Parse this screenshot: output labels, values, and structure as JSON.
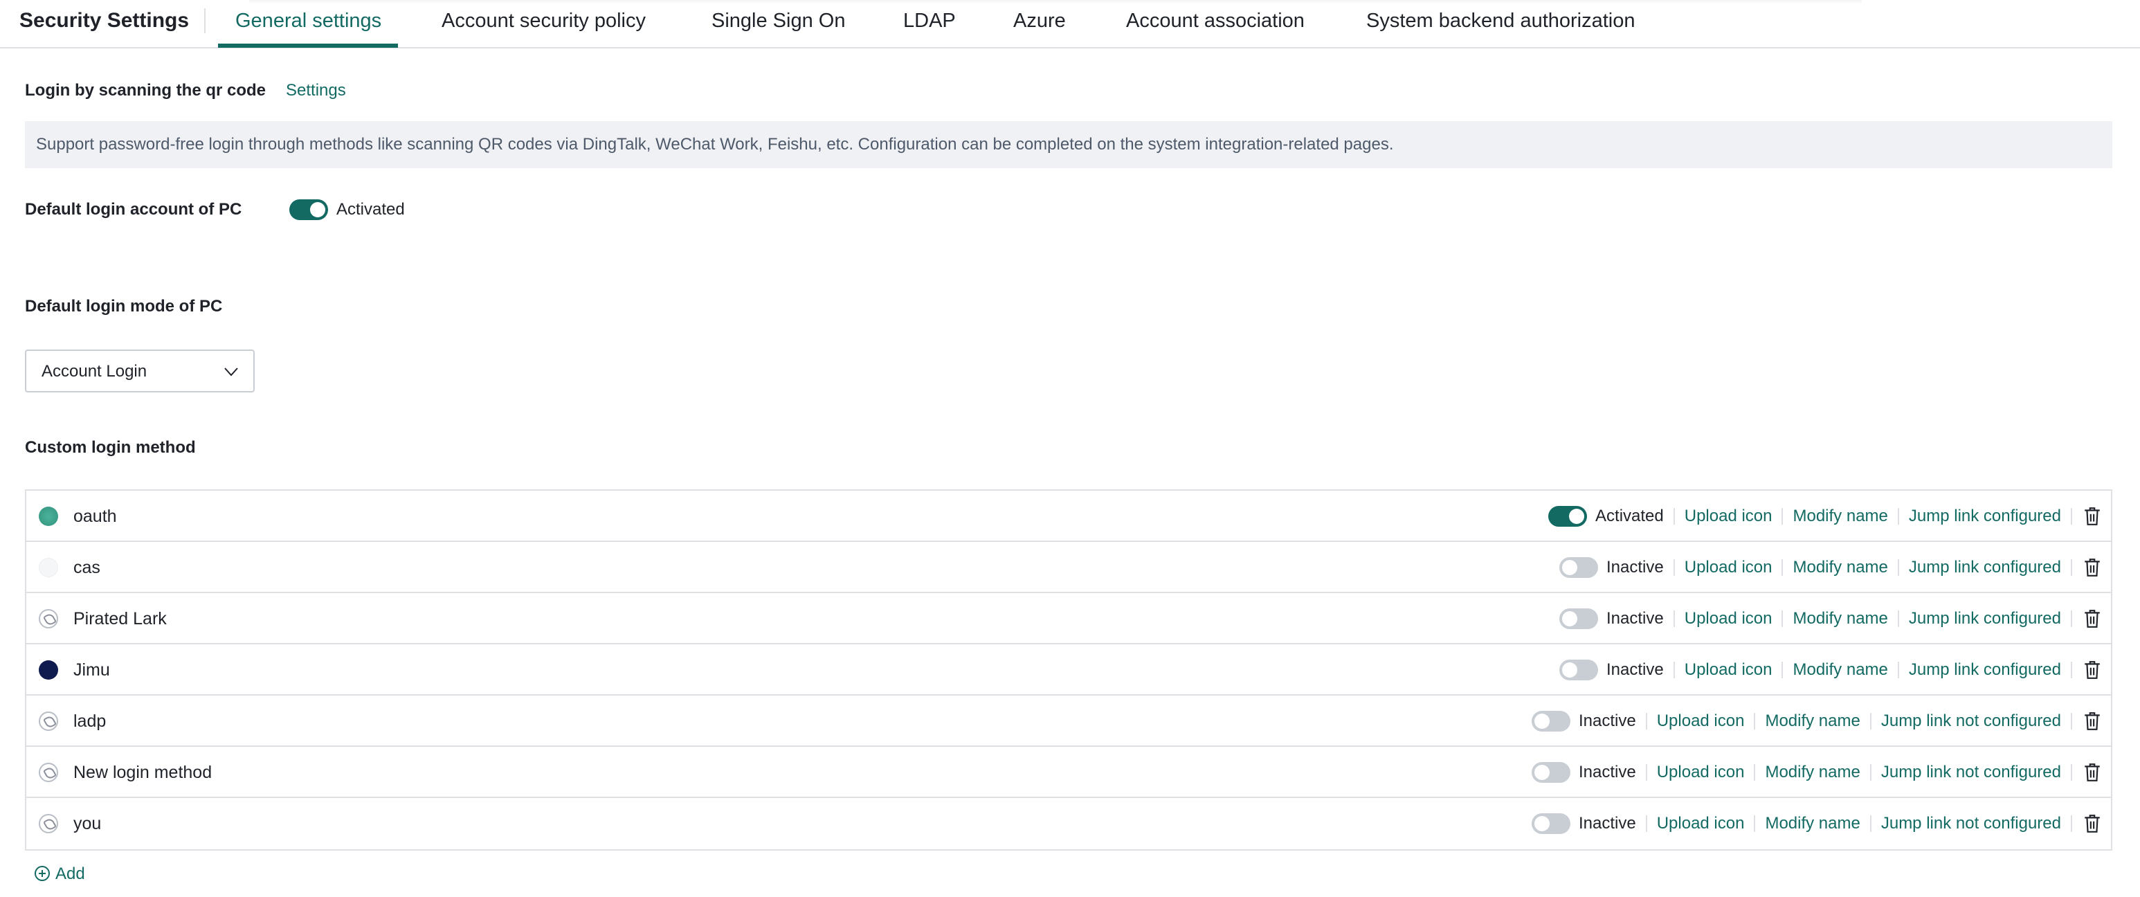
{
  "header": {
    "title": "Security Settings",
    "tabs": [
      {
        "label": "General settings",
        "active": true
      },
      {
        "label": "Account security policy",
        "active": false
      },
      {
        "label": "Single Sign On",
        "active": false
      },
      {
        "label": "LDAP",
        "active": false
      },
      {
        "label": "Azure",
        "active": false
      },
      {
        "label": "Account association",
        "active": false
      },
      {
        "label": "System backend authorization",
        "active": false
      }
    ]
  },
  "qr_login": {
    "label": "Login by scanning the qr code",
    "settings_link": "Settings",
    "notice": "Support password-free login through methods like scanning QR codes via DingTalk, WeChat Work, Feishu, etc. Configuration can be completed on the system integration-related pages."
  },
  "default_account": {
    "label": "Default login account of PC",
    "enabled": true,
    "status": "Activated"
  },
  "default_mode": {
    "label": "Default login mode of PC",
    "selected": "Account Login"
  },
  "custom_methods": {
    "label": "Custom login method",
    "actions": {
      "upload_icon": "Upload icon",
      "modify_name": "Modify name"
    },
    "rows": [
      {
        "name": "oauth",
        "icon": "globe-icon",
        "enabled": true,
        "status": "Activated",
        "jump_link": "Jump link configured"
      },
      {
        "name": "cas",
        "icon": "blank-image-icon",
        "enabled": false,
        "status": "Inactive",
        "jump_link": "Jump link configured"
      },
      {
        "name": "Pirated Lark",
        "icon": "broken-image-icon",
        "enabled": false,
        "status": "Inactive",
        "jump_link": "Jump link configured"
      },
      {
        "name": "Jimu",
        "icon": "dark-circle-icon",
        "enabled": false,
        "status": "Inactive",
        "jump_link": "Jump link configured"
      },
      {
        "name": "ladp",
        "icon": "broken-image-icon",
        "enabled": false,
        "status": "Inactive",
        "jump_link": "Jump link not configured"
      },
      {
        "name": "New login method",
        "icon": "broken-image-icon",
        "enabled": false,
        "status": "Inactive",
        "jump_link": "Jump link not configured"
      },
      {
        "name": "you",
        "icon": "broken-image-icon",
        "enabled": false,
        "status": "Inactive",
        "jump_link": "Jump link not configured"
      }
    ],
    "add_label": "Add"
  },
  "colors": {
    "accent": "#136a63",
    "border": "#dee0e3",
    "notice_bg": "#f0f1f5"
  }
}
